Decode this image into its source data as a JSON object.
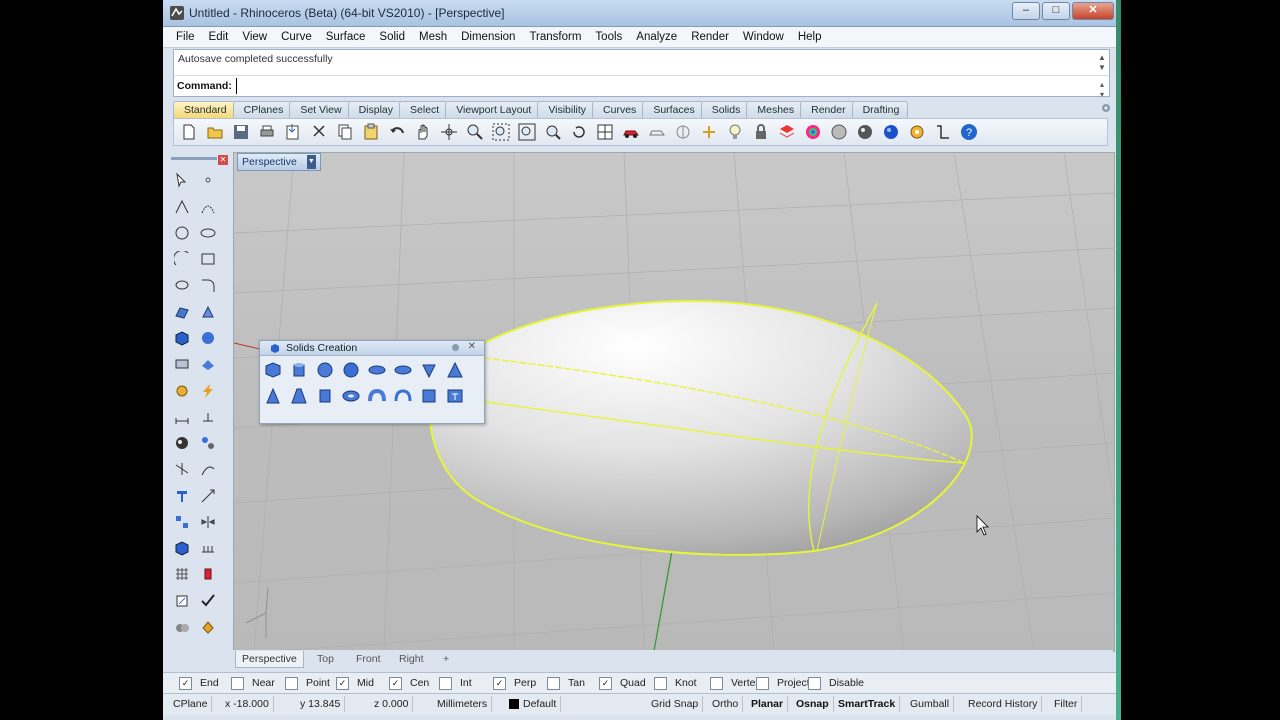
{
  "window": {
    "title": "Untitled - Rhinoceros (Beta) (64-bit VS2010) - [Perspective]"
  },
  "menu": [
    "File",
    "Edit",
    "View",
    "Curve",
    "Surface",
    "Solid",
    "Mesh",
    "Dimension",
    "Transform",
    "Tools",
    "Analyze",
    "Render",
    "Window",
    "Help"
  ],
  "command": {
    "history": "Autosave completed successfully",
    "label": "Command:",
    "value": ""
  },
  "toolbar_tabs": [
    "Standard",
    "CPlanes",
    "Set View",
    "Display",
    "Select",
    "Viewport Layout",
    "Visibility",
    "Curves",
    "Surfaces",
    "Solids",
    "Meshes",
    "Render",
    "Drafting"
  ],
  "viewport": {
    "label": "Perspective"
  },
  "floating_toolbar": {
    "title": "Solids Creation"
  },
  "viewport_tabs": [
    "Perspective",
    "Top",
    "Front",
    "Right"
  ],
  "osnaps": [
    {
      "label": "End",
      "checked": true
    },
    {
      "label": "Near",
      "checked": false
    },
    {
      "label": "Point",
      "checked": false
    },
    {
      "label": "Mid",
      "checked": true
    },
    {
      "label": "Cen",
      "checked": true
    },
    {
      "label": "Int",
      "checked": false
    },
    {
      "label": "Perp",
      "checked": true
    },
    {
      "label": "Tan",
      "checked": false
    },
    {
      "label": "Quad",
      "checked": true
    },
    {
      "label": "Knot",
      "checked": false
    },
    {
      "label": "Vertex",
      "checked": false
    },
    {
      "label": "Project",
      "checked": false
    },
    {
      "label": "Disable",
      "checked": false
    }
  ],
  "status": {
    "cplane": "CPlane",
    "x": "x -18.000",
    "y": "y 13.845",
    "z": "z 0.000",
    "units": "Millimeters",
    "layer": "Default",
    "grid_snap": "Grid Snap",
    "ortho": "Ortho",
    "planar": "Planar",
    "osnap": "Osnap",
    "smarttrack": "SmartTrack",
    "gumball": "Gumball",
    "record_history": "Record History",
    "filter": "Filter"
  },
  "colors": {
    "selection": "#e6f53a",
    "x_axis": "#c03030",
    "y_axis": "#2a9a2a"
  }
}
